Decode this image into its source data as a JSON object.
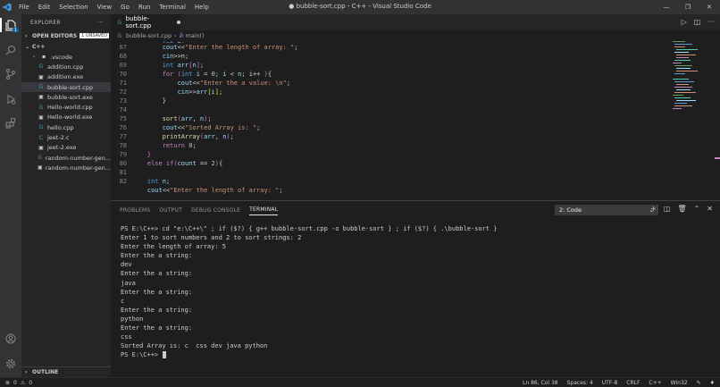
{
  "window": {
    "title": "● bubble-sort.cpp - C++ - Visual Studio Code",
    "menu": [
      "File",
      "Edit",
      "Selection",
      "View",
      "Go",
      "Run",
      "Terminal",
      "Help"
    ]
  },
  "colors": {
    "accent": "#0e639c",
    "keyword": "#569cd6",
    "control": "#c586c0",
    "string": "#ce9178",
    "function": "#dcdcaa",
    "variable": "#9cdcfe"
  },
  "activity_bar": {
    "items": [
      "explorer-icon",
      "search-icon",
      "source-control-icon",
      "run-debug-icon",
      "extensions-icon"
    ],
    "badge": "1",
    "bottom": [
      "account-icon",
      "settings-gear-icon"
    ]
  },
  "sidebar": {
    "header": "EXPLORER",
    "open_editors": "OPEN EDITORS",
    "unsaved": "1 UNSAVED",
    "folder": "C++",
    "items": [
      {
        "label": ".vscode",
        "type": "folder"
      },
      {
        "label": "addition.cpp",
        "type": "cpp"
      },
      {
        "label": "addition.exe",
        "type": "exe"
      },
      {
        "label": "bubble-sort.cpp",
        "type": "cpp",
        "selected": true
      },
      {
        "label": "bubble-sort.exe",
        "type": "exe"
      },
      {
        "label": "Hello-world.cpp",
        "type": "cpp"
      },
      {
        "label": "Hello-world.exe",
        "type": "exe"
      },
      {
        "label": "hello.cpp",
        "type": "cpp"
      },
      {
        "label": "jeet-2.c",
        "type": "c"
      },
      {
        "label": "jeet-2.exe",
        "type": "exe"
      },
      {
        "label": "random-number-gen...",
        "type": "cpp"
      },
      {
        "label": "random-number-gen...",
        "type": "exe"
      }
    ],
    "outline": "OUTLINE"
  },
  "editor": {
    "tab": "bubble-sort.cpp",
    "breadcrumb": {
      "file": "bubble-sort.cpp",
      "symbol": "main()"
    },
    "line_numbers": [
      "67",
      "68",
      "69",
      "70",
      "71",
      "72",
      "73",
      "74",
      "75",
      "76",
      "77",
      "78",
      "79",
      "80",
      "81",
      "82"
    ]
  },
  "panel": {
    "tabs": [
      "PROBLEMS",
      "OUTPUT",
      "DEBUG CONSOLE",
      "TERMINAL"
    ],
    "active_tab": "TERMINAL",
    "terminal_select": "2: Code",
    "lines": [
      "PS E:\\C++> cd \"e:\\C++\\\" ; if ($?) { g++ bubble-sort.cpp -o bubble-sort } ; if ($?) { .\\bubble-sort }",
      "Enter 1 to sort numbers and 2 to sort strings: 2",
      "Enter the length of array: 5",
      "Enter the a string:",
      "dev",
      "Enter the a string:",
      "java",
      "Enter the a string:",
      "c",
      "Enter the a string:",
      "python",
      "Enter the a string:",
      "css",
      "Sorted Array is: c  css dev java python"
    ],
    "prompt": "PS E:\\C++> "
  },
  "status_bar": {
    "errors": "0",
    "warnings": "0",
    "position": "Ln 86, Col 38",
    "spaces": "Spaces: 4",
    "encoding": "UTF-8",
    "eol": "CRLF",
    "language": "C++",
    "platform": "Win32"
  }
}
